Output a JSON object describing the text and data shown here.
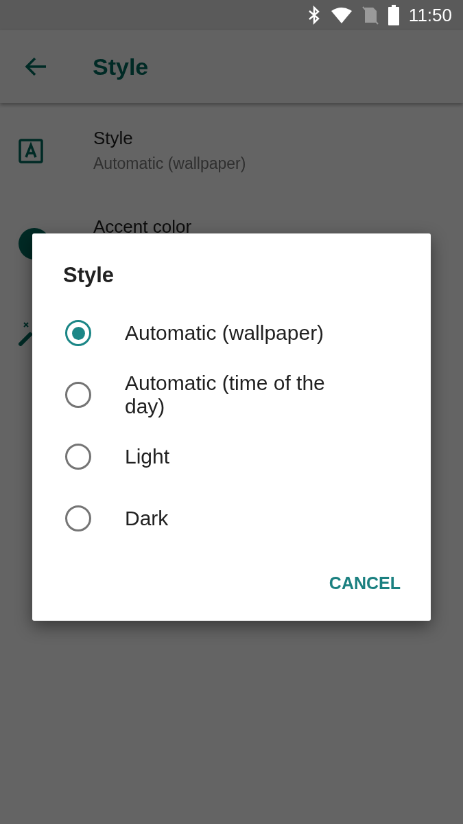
{
  "status_bar": {
    "time": "11:50"
  },
  "app_bar": {
    "title": "Style"
  },
  "preferences": [
    {
      "title": "Style",
      "summary": "Automatic (wallpaper)"
    },
    {
      "title": "Accent color"
    }
  ],
  "dialog": {
    "title": "Style",
    "options": [
      {
        "label": "Automatic (wallpaper)",
        "selected": true
      },
      {
        "label": "Automatic (time of the day)",
        "selected": false
      },
      {
        "label": "Light",
        "selected": false
      },
      {
        "label": "Dark",
        "selected": false
      }
    ],
    "buttons": [
      "CANCEL"
    ]
  }
}
